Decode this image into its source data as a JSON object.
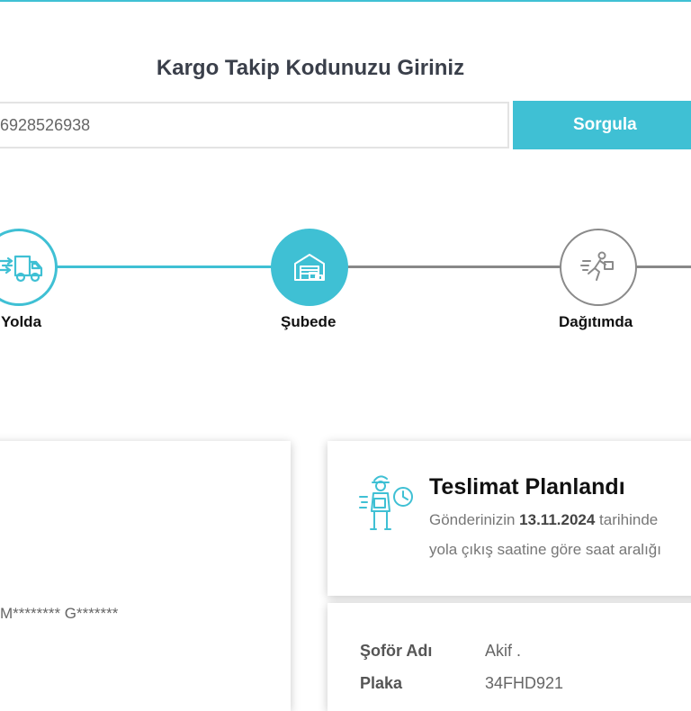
{
  "header": {
    "title": "Kargo Takip Kodunuzu Giriniz"
  },
  "search": {
    "value": "6928526938",
    "button_label": "Sorgula"
  },
  "steps": [
    {
      "label": "Yolda",
      "state": "done",
      "icon": "delivery-truck-icon"
    },
    {
      "label": "Şubede",
      "state": "current",
      "icon": "warehouse-icon"
    },
    {
      "label": "Dağıtımda",
      "state": "pending",
      "icon": "running-courier-icon"
    }
  ],
  "recipient": {
    "masked_name": "M******** G*******"
  },
  "status": {
    "icon": "courier-clock-icon",
    "title": "Teslimat Planlandı",
    "line1_prefix": "Gönderinizin ",
    "line1_date": "13.11.2024",
    "line1_suffix": " tarihinde",
    "line2": "yola çıkış saatine göre saat aralığı"
  },
  "driver": {
    "name_label": "Şoför Adı",
    "name_value": "Akif .",
    "plate_label": "Plaka",
    "plate_value": "34FHD921"
  },
  "colors": {
    "accent": "#3fc0d4",
    "inactive": "#888888"
  }
}
